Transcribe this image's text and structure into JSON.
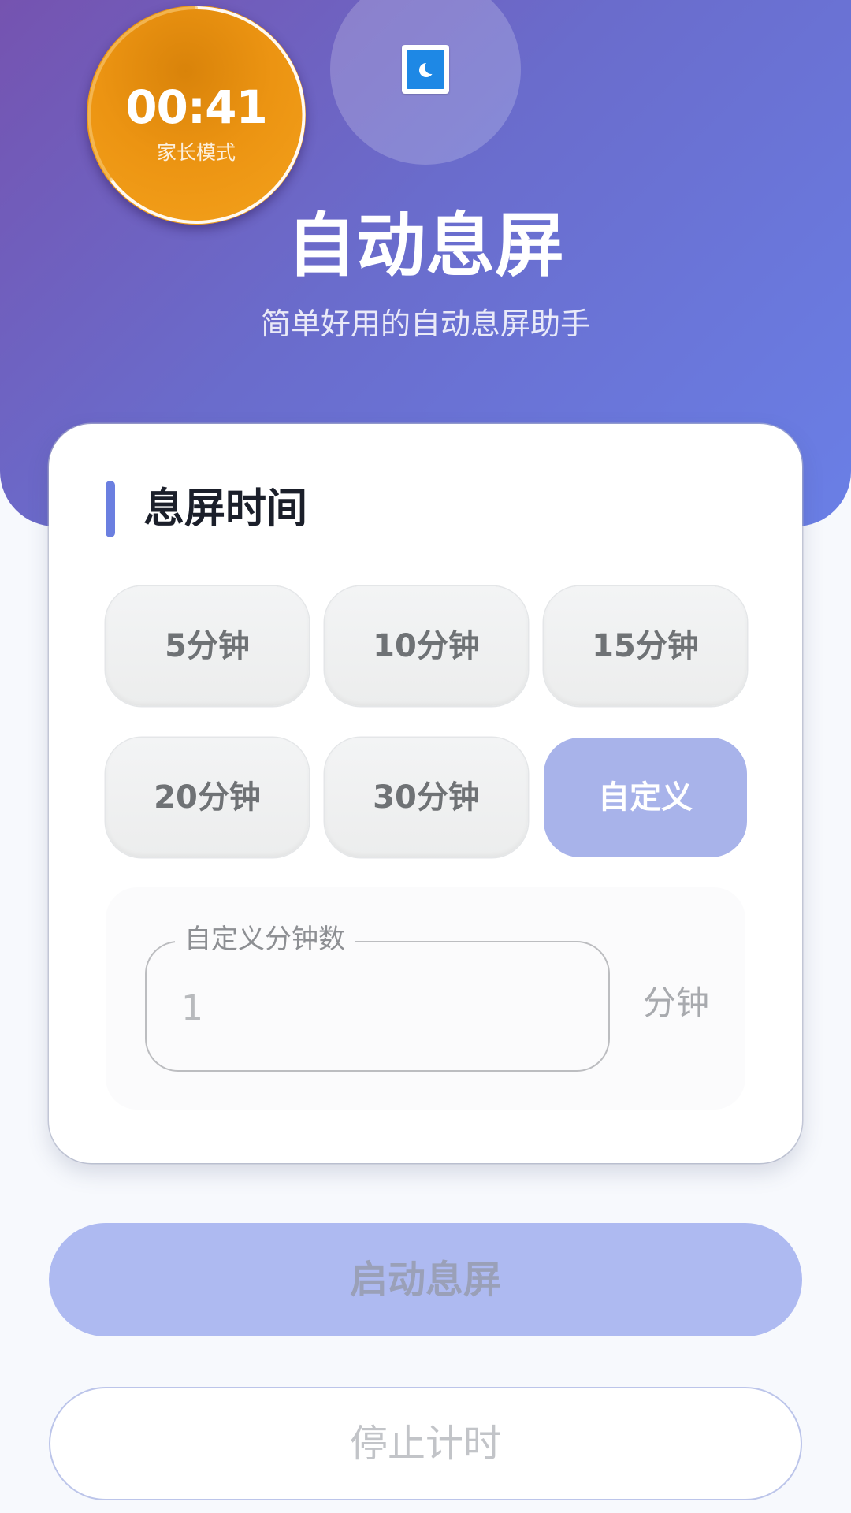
{
  "app": {
    "icon": "moon-screen-app-icon",
    "title": "自动息屏",
    "subtitle": "简单好用的自动息屏助手"
  },
  "timer": {
    "time": "00:41",
    "mode": "家长模式"
  },
  "card": {
    "title": "息屏时间",
    "options": [
      {
        "label": "5分钟",
        "selected": false
      },
      {
        "label": "10分钟",
        "selected": false
      },
      {
        "label": "15分钟",
        "selected": false
      },
      {
        "label": "20分钟",
        "selected": false
      },
      {
        "label": "30分钟",
        "selected": false
      },
      {
        "label": "自定义",
        "selected": true
      }
    ],
    "custom": {
      "label": "自定义分钟数",
      "value": "1",
      "unit": "分钟"
    }
  },
  "actions": {
    "start_label": "启动息屏",
    "stop_label": "停止计时"
  },
  "colors": {
    "accent": "#6b7fe0",
    "timer_orange": "#ec9412",
    "selected_option": "#a8b3ea",
    "start_button": "#aebaf1"
  }
}
